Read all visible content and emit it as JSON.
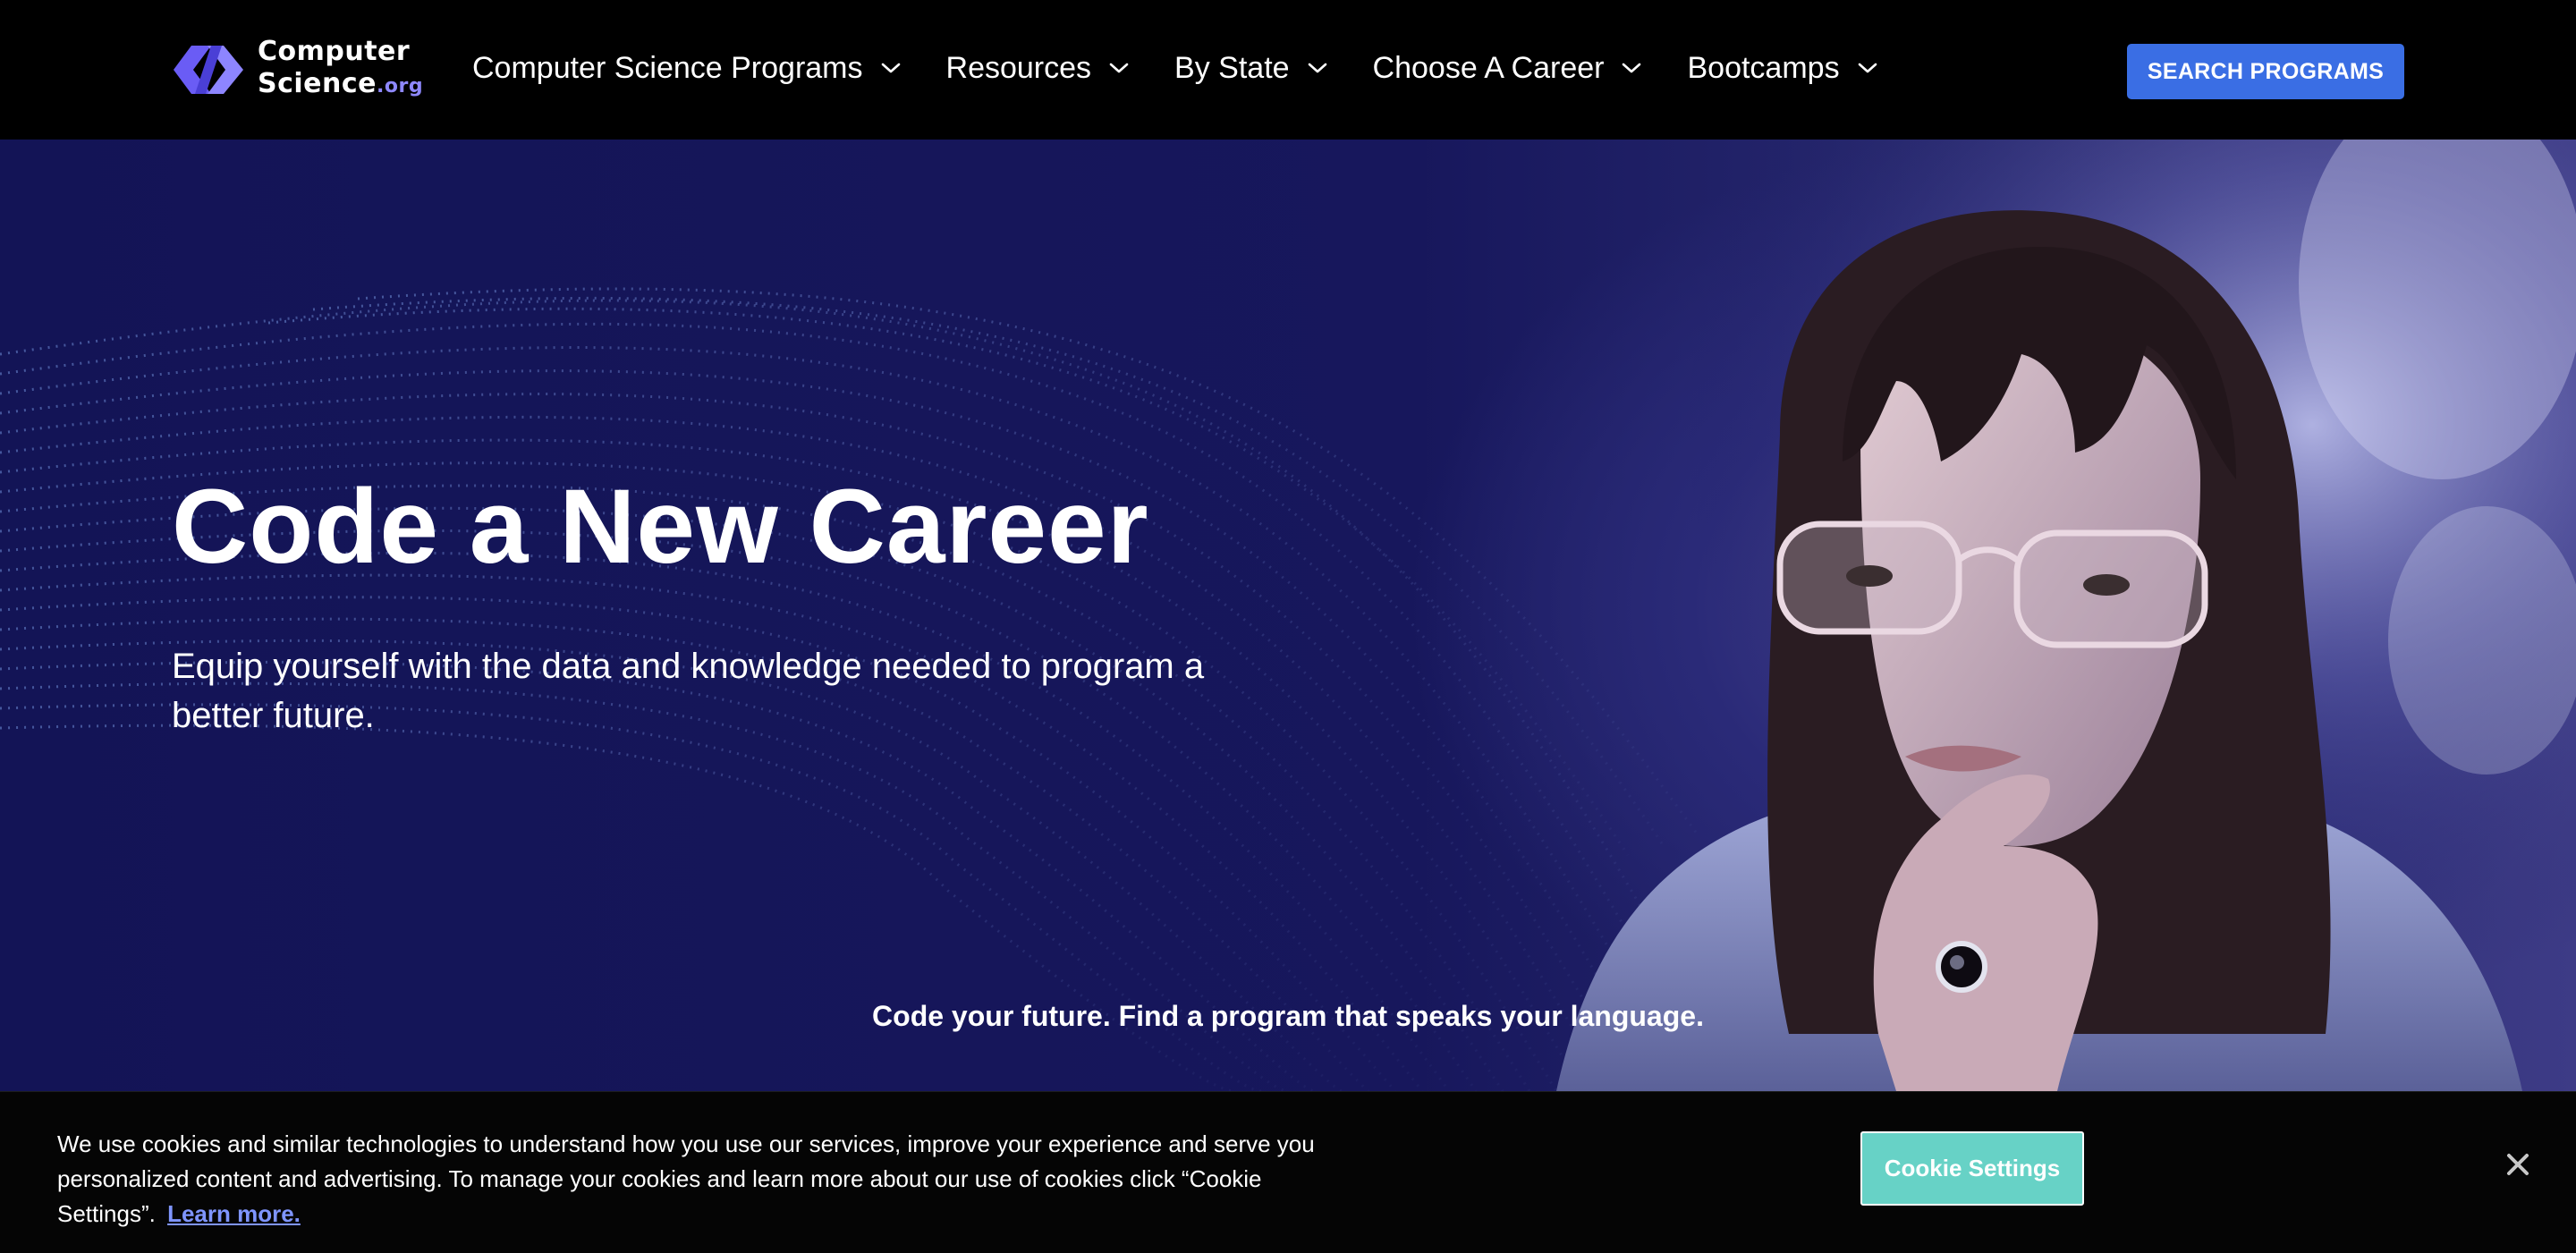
{
  "header": {
    "logo": {
      "line1": "Computer",
      "line2": "Science",
      "suffix": ".org"
    },
    "nav": [
      {
        "label": "Computer Science Programs",
        "icon": "chevron-down-icon"
      },
      {
        "label": "Resources",
        "icon": "chevron-down-icon"
      },
      {
        "label": "By State",
        "icon": "chevron-down-icon"
      },
      {
        "label": "Choose A Career",
        "icon": "chevron-down-icon"
      },
      {
        "label": "Bootcamps",
        "icon": "chevron-down-icon"
      }
    ],
    "cta_label": "SEARCH PROGRAMS"
  },
  "hero": {
    "title": "Code a New Career",
    "subtitle": "Equip yourself with the data and knowledge needed to program a better future.",
    "tagline": "Code your future. Find a program that speaks your language."
  },
  "cookie_banner": {
    "text": "We use cookies and similar technologies to understand how you use our services, improve your experience and serve you personalized content and advertising. To manage your cookies and learn more about our use of cookies click “Cookie Settings”.",
    "link_label": "Learn more.",
    "button_label": "Cookie Settings",
    "close_icon": "close-icon"
  },
  "colors": {
    "header_bg": "#000000",
    "accent_button": "#3a6ee4",
    "logo_purple": "#6a5cf5",
    "hero_bg": "#17175c",
    "cookie_button": "#67d2c6",
    "cookie_link": "#7f95ff"
  }
}
